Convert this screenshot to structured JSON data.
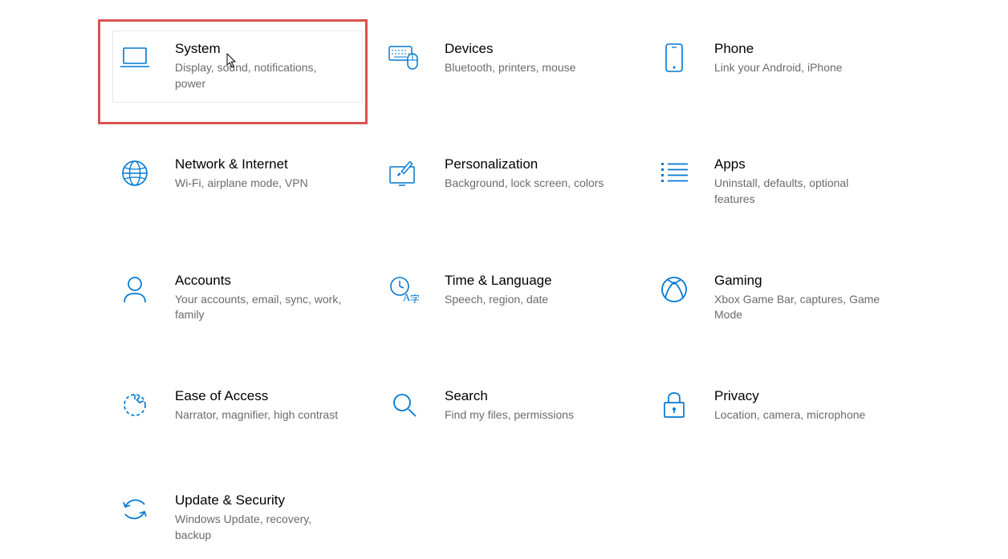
{
  "accent": "#0078d4",
  "tiles": [
    {
      "id": "system",
      "title": "System",
      "desc": "Display, sound, notifications, power",
      "icon": "laptop"
    },
    {
      "id": "devices",
      "title": "Devices",
      "desc": "Bluetooth, printers, mouse",
      "icon": "keyboard-mouse"
    },
    {
      "id": "phone",
      "title": "Phone",
      "desc": "Link your Android, iPhone",
      "icon": "phone"
    },
    {
      "id": "network",
      "title": "Network & Internet",
      "desc": "Wi-Fi, airplane mode, VPN",
      "icon": "globe"
    },
    {
      "id": "personalization",
      "title": "Personalization",
      "desc": "Background, lock screen, colors",
      "icon": "pen-monitor"
    },
    {
      "id": "apps",
      "title": "Apps",
      "desc": "Uninstall, defaults, optional features",
      "icon": "list"
    },
    {
      "id": "accounts",
      "title": "Accounts",
      "desc": "Your accounts, email, sync, work, family",
      "icon": "person"
    },
    {
      "id": "time-language",
      "title": "Time & Language",
      "desc": "Speech, region, date",
      "icon": "time-lang"
    },
    {
      "id": "gaming",
      "title": "Gaming",
      "desc": "Xbox Game Bar, captures, Game Mode",
      "icon": "xbox"
    },
    {
      "id": "ease-of-access",
      "title": "Ease of Access",
      "desc": "Narrator, magnifier, high contrast",
      "icon": "ease"
    },
    {
      "id": "search",
      "title": "Search",
      "desc": "Find my files, permissions",
      "icon": "search"
    },
    {
      "id": "privacy",
      "title": "Privacy",
      "desc": "Location, camera, microphone",
      "icon": "lock"
    },
    {
      "id": "update-security",
      "title": "Update & Security",
      "desc": "Windows Update, recovery, backup",
      "icon": "sync"
    }
  ],
  "highlight_tile": "system"
}
